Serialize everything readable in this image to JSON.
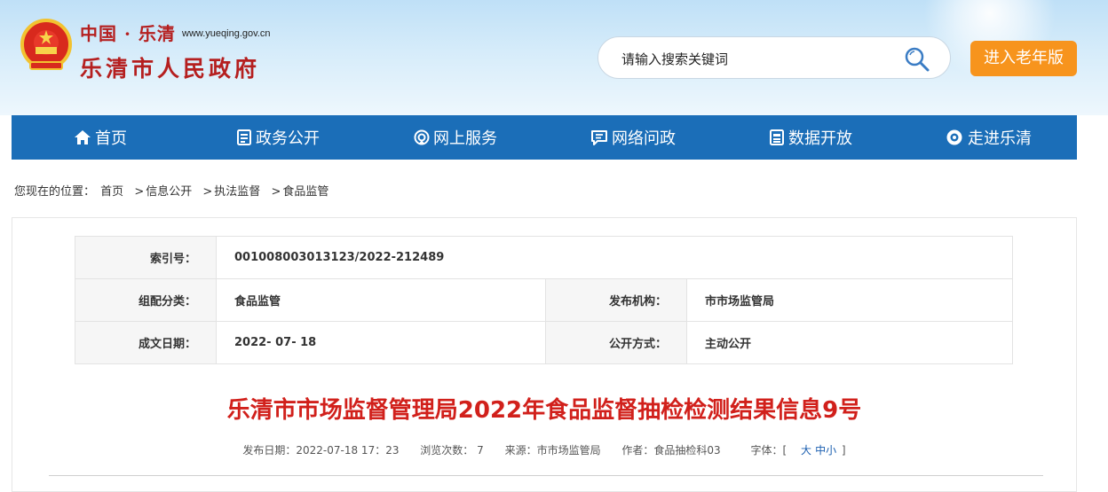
{
  "header": {
    "site_prefix": "中国 · 乐清",
    "site_url": "www.yueqing.gov.cn",
    "site_name": "乐清市人民政府",
    "search_placeholder": "请输入搜索关键词",
    "elder_mode_label": "进入老年版"
  },
  "colors": {
    "nav_bg": "#1b6eb8",
    "title_red": "#d1201b",
    "brand_red": "#b51f1f",
    "elder_button": "#f7941d"
  },
  "nav": {
    "items": [
      {
        "label": "首页",
        "icon": "home-icon"
      },
      {
        "label": "政务公开",
        "icon": "document-icon"
      },
      {
        "label": "网上服务",
        "icon": "service-icon"
      },
      {
        "label": "网络问政",
        "icon": "chat-icon"
      },
      {
        "label": "数据开放",
        "icon": "data-icon"
      },
      {
        "label": "走进乐清",
        "icon": "eye-icon"
      }
    ]
  },
  "breadcrumb": {
    "prefix": "您现在的位置：",
    "items": [
      "首页",
      "信息公开",
      "执法监督",
      "食品监管"
    ]
  },
  "meta_table": {
    "index_label": "索引号：",
    "index_value": "001008003013123/2022-212489",
    "category_label": "组配分类：",
    "category_value": "食品监管",
    "publisher_label": "发布机构：",
    "publisher_value": "市市场监管局",
    "date_label": "成文日期：",
    "date_value": "2022- 07- 18",
    "open_mode_label": "公开方式：",
    "open_mode_value": "主动公开"
  },
  "article": {
    "title": "乐清市市场监督管理局2022年食品监督抽检检测结果信息9号",
    "publish_date": "发布日期：2022-07-18 17：23",
    "views": "浏览次数：  7",
    "source": "来源：市市场监管局",
    "author": "作者：食品抽检科03",
    "font_size_label": "字体：[",
    "font_large": "大",
    "font_medium": "中",
    "font_small": "小",
    "font_size_end": "]"
  }
}
